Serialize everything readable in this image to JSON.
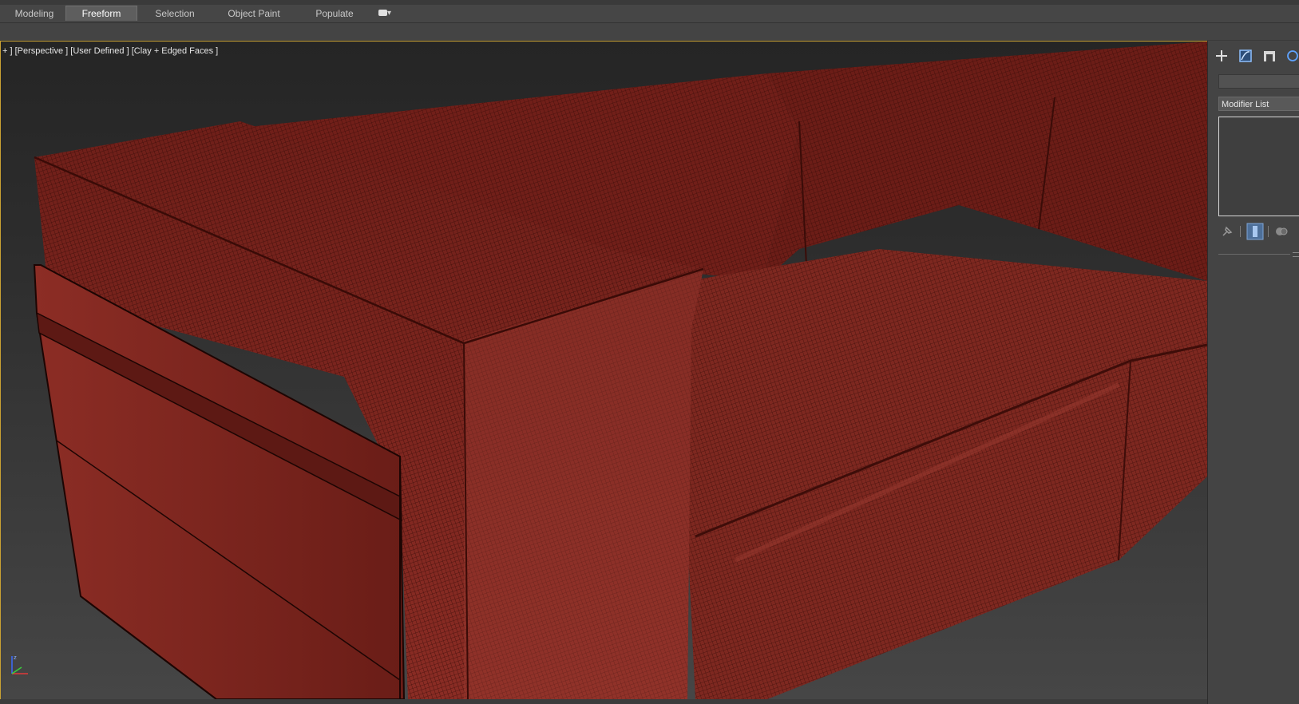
{
  "ribbon": {
    "tabs": [
      {
        "label": "Modeling",
        "active": false
      },
      {
        "label": "Freeform",
        "active": true
      },
      {
        "label": "Selection",
        "active": false
      },
      {
        "label": "Object Paint",
        "active": false
      },
      {
        "label": "Populate",
        "active": false
      }
    ]
  },
  "viewport": {
    "label": "+ ] [Perspective ] [User Defined ] [Clay + Edged Faces ]",
    "active_border_color": "#c9a133",
    "object_color": "#8a2e26"
  },
  "command_panel": {
    "tabs": [
      {
        "icon": "create-plus-icon"
      },
      {
        "icon": "modify-icon",
        "active": true
      },
      {
        "icon": "hierarchy-icon"
      },
      {
        "icon": "motion-icon"
      }
    ],
    "modifier_list_label": "Modifier List",
    "stack_tools": [
      {
        "icon": "pin-stack-icon"
      },
      {
        "icon": "show-end-result-icon",
        "active": true
      },
      {
        "icon": "make-unique-icon"
      }
    ]
  },
  "icons": {
    "axis_tripod": "axis-tripod-icon",
    "ribbon_toggle": "ribbon-minimize-toggle-icon"
  }
}
